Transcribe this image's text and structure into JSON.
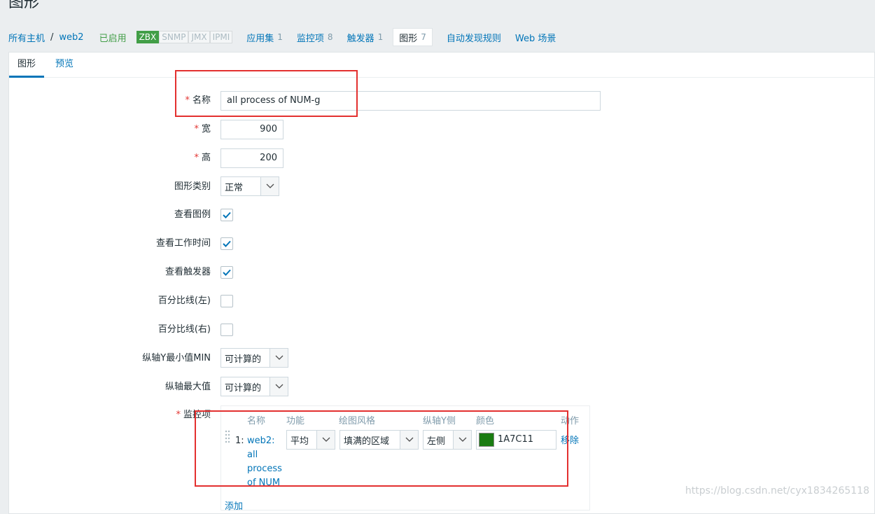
{
  "page": {
    "title": "图形"
  },
  "breadcrumb": {
    "all_hosts": "所有主机",
    "separator": "/",
    "host": "web2"
  },
  "status": {
    "enabled": "已启用"
  },
  "badges": [
    {
      "label": "ZBX",
      "active": true
    },
    {
      "label": "SNMP",
      "active": false
    },
    {
      "label": "JMX",
      "active": false
    },
    {
      "label": "IPMI",
      "active": false
    }
  ],
  "host_tabs": {
    "applications": {
      "label": "应用集",
      "count": "1"
    },
    "items": {
      "label": "监控项",
      "count": "8"
    },
    "triggers": {
      "label": "触发器",
      "count": "1"
    },
    "graphs": {
      "label": "图形",
      "count": "7"
    },
    "discovery": {
      "label": "自动发现规则"
    },
    "web": {
      "label": "Web 场景"
    }
  },
  "subtabs": {
    "graph": "图形",
    "preview": "预览"
  },
  "form": {
    "name": {
      "label": "名称",
      "value": "all process  of  NUM-g"
    },
    "width": {
      "label": "宽",
      "value": "900"
    },
    "height": {
      "label": "高",
      "value": "200"
    },
    "graph_type": {
      "label": "图形类别",
      "value": "正常"
    },
    "show_legend": {
      "label": "查看图例",
      "checked": true
    },
    "show_working_time": {
      "label": "查看工作时间",
      "checked": true
    },
    "show_triggers": {
      "label": "查看触发器",
      "checked": true
    },
    "percentile_left": {
      "label": "百分比线(左)",
      "checked": false
    },
    "percentile_right": {
      "label": "百分比线(右)",
      "checked": false
    },
    "y_min": {
      "label": "纵轴Y最小值MIN",
      "value": "可计算的"
    },
    "y_max": {
      "label": "纵轴最大值",
      "value": "可计算的"
    },
    "items": {
      "label": "监控项",
      "headers": {
        "name": "名称",
        "function": "功能",
        "draw_style": "绘图风格",
        "y_axis_side": "纵轴Y侧",
        "color": "颜色",
        "action": "动作"
      },
      "rows": [
        {
          "index": "1:",
          "name_lines": [
            "web2:",
            "all",
            "process",
            "of NUM"
          ],
          "function": "平均",
          "draw_style": "填满的区域",
          "y_axis_side": "左侧",
          "color": "1A7C11",
          "remove": "移除"
        }
      ],
      "add": "添加"
    }
  },
  "watermark": "https://blog.csdn.net/cyx1834265118",
  "colors": {
    "link": "#0275b8",
    "enabled": "#429e47",
    "required": "#e33734",
    "swatch": "#1A7C11",
    "annotation": "#e3302f"
  }
}
